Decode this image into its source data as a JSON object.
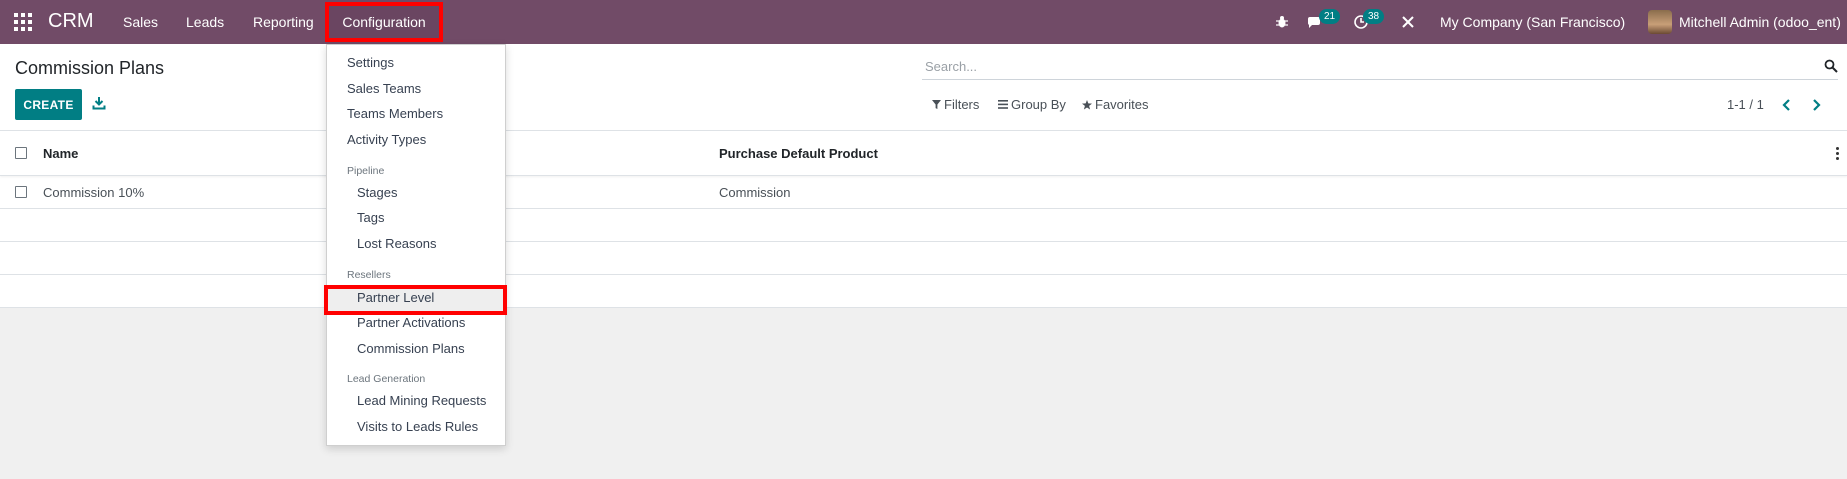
{
  "navbar": {
    "brand": "CRM",
    "menu": [
      "Sales",
      "Leads",
      "Reporting"
    ],
    "active_menu": "Configuration",
    "messages_count": "21",
    "activities_count": "38",
    "company": "My Company (San Francisco)",
    "user": "Mitchell Admin (odoo_ent)",
    "icons": [
      "apps-grid-icon",
      "bug-icon",
      "chat-icon",
      "clock-icon",
      "tools-icon"
    ]
  },
  "control": {
    "title": "Commission Plans",
    "create_label": "CREATE",
    "search_placeholder": "Search...",
    "filters_label": "Filters",
    "groupby_label": "Group By",
    "favorites_label": "Favorites",
    "pager": "1-1 / 1"
  },
  "list": {
    "columns": [
      "Name",
      "Purchase Default Product"
    ],
    "rows": [
      {
        "name": "Commission 10%",
        "product": "Commission"
      }
    ]
  },
  "dropdown": {
    "items_top": [
      "Settings",
      "Sales Teams",
      "Teams Members",
      "Activity Types"
    ],
    "pipeline_header": "Pipeline",
    "pipeline_items": [
      "Stages",
      "Tags",
      "Lost Reasons"
    ],
    "resellers_header": "Resellers",
    "resellers_items": [
      "Partner Level",
      "Partner Activations",
      "Commission Plans"
    ],
    "leadgen_header": "Lead Generation",
    "leadgen_items": [
      "Lead Mining Requests",
      "Visits to Leads Rules"
    ]
  },
  "colors": {
    "navbar": "#714b67",
    "accent": "#017e84",
    "highlight_border": "#ff0000"
  }
}
